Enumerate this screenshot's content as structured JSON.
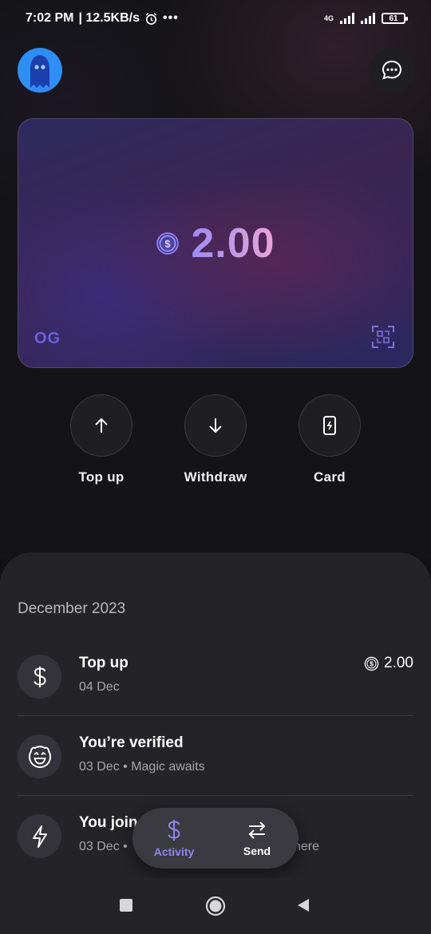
{
  "status_bar": {
    "time": "7:02 PM",
    "speed": "| 12.5KB/s",
    "network": "4G",
    "battery": "61"
  },
  "header": {
    "avatar_icon": "ghost-avatar-icon",
    "chat_icon": "chat-bubble-icon"
  },
  "card": {
    "currency_icon": "usd-coin-icon",
    "balance": "2.00",
    "logo": "OG",
    "scan_icon": "scan-qr-icon"
  },
  "actions": [
    {
      "label": "Top up",
      "icon": "arrow-up-icon"
    },
    {
      "label": "Withdraw",
      "icon": "arrow-down-icon"
    },
    {
      "label": "Card",
      "icon": "card-icon"
    }
  ],
  "activity": {
    "month": "December 2023",
    "transactions": [
      {
        "title": "Top up",
        "subtitle": "04 Dec",
        "amount": "2.00",
        "icon": "dollar-icon"
      },
      {
        "title": "You’re verified",
        "subtitle": "03 Dec • Magic awaits",
        "icon": "smile-face-icon"
      },
      {
        "title": "You join",
        "subtitle": "03 Dec •",
        "subtitle_tail": "here",
        "icon": "lightning-icon"
      }
    ]
  },
  "bottom_nav": {
    "activity_label": "Activity",
    "send_label": "Send"
  },
  "colors": {
    "accent": "#8d86f2",
    "background": "#121214",
    "sheet": "#232328"
  }
}
